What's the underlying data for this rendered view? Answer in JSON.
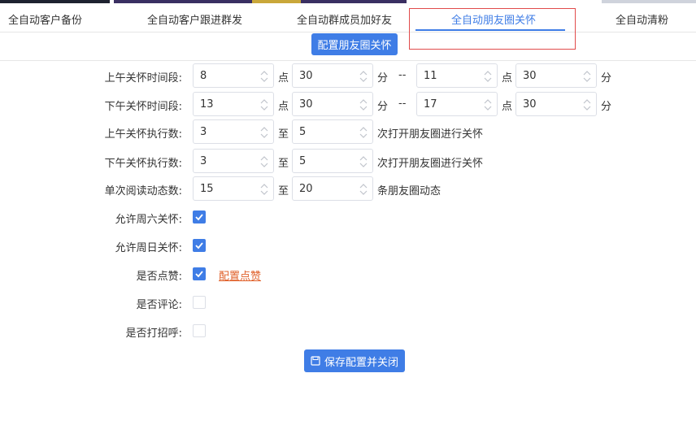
{
  "tabs": [
    {
      "label": "全自动客户备份",
      "active": false
    },
    {
      "label": "全自动客户跟进群发",
      "active": false
    },
    {
      "label": "全自动群成员加好友",
      "active": false
    },
    {
      "label": "全自动朋友圈关怀",
      "active": true
    },
    {
      "label": "全自动清粉",
      "active": false
    }
  ],
  "config_button_label": "配置朋友圈关怀",
  "form": {
    "morning_period": {
      "label": "上午关怀时间段:",
      "start_hour": "8",
      "start_min": "30",
      "end_hour": "11",
      "end_min": "30",
      "unit_hour": "点",
      "unit_min": "分",
      "sep": "--"
    },
    "afternoon_period": {
      "label": "下午关怀时间段:",
      "start_hour": "13",
      "start_min": "30",
      "end_hour": "17",
      "end_min": "30",
      "unit_hour": "点",
      "unit_min": "分",
      "sep": "--"
    },
    "morning_count": {
      "label": "上午关怀执行数:",
      "min": "3",
      "max": "5",
      "to": "至",
      "suffix": "次打开朋友圈进行关怀"
    },
    "afternoon_count": {
      "label": "下午关怀执行数:",
      "min": "3",
      "max": "5",
      "to": "至",
      "suffix": "次打开朋友圈进行关怀"
    },
    "read_count": {
      "label": "单次阅读动态数:",
      "min": "15",
      "max": "20",
      "to": "至",
      "suffix": "条朋友圈动态"
    },
    "allow_saturday": {
      "label": "允许周六关怀:",
      "checked": true
    },
    "allow_sunday": {
      "label": "允许周日关怀:",
      "checked": true
    },
    "like": {
      "label": "是否点赞:",
      "checked": true,
      "link": "配置点赞"
    },
    "comment": {
      "label": "是否评论:",
      "checked": false
    },
    "greet": {
      "label": "是否打招呼:",
      "checked": false
    }
  },
  "save_button_label": "保存配置并关闭",
  "colors": {
    "accent": "#3f7de6",
    "link": "#e0612b",
    "highlight": "#e14b4b"
  }
}
